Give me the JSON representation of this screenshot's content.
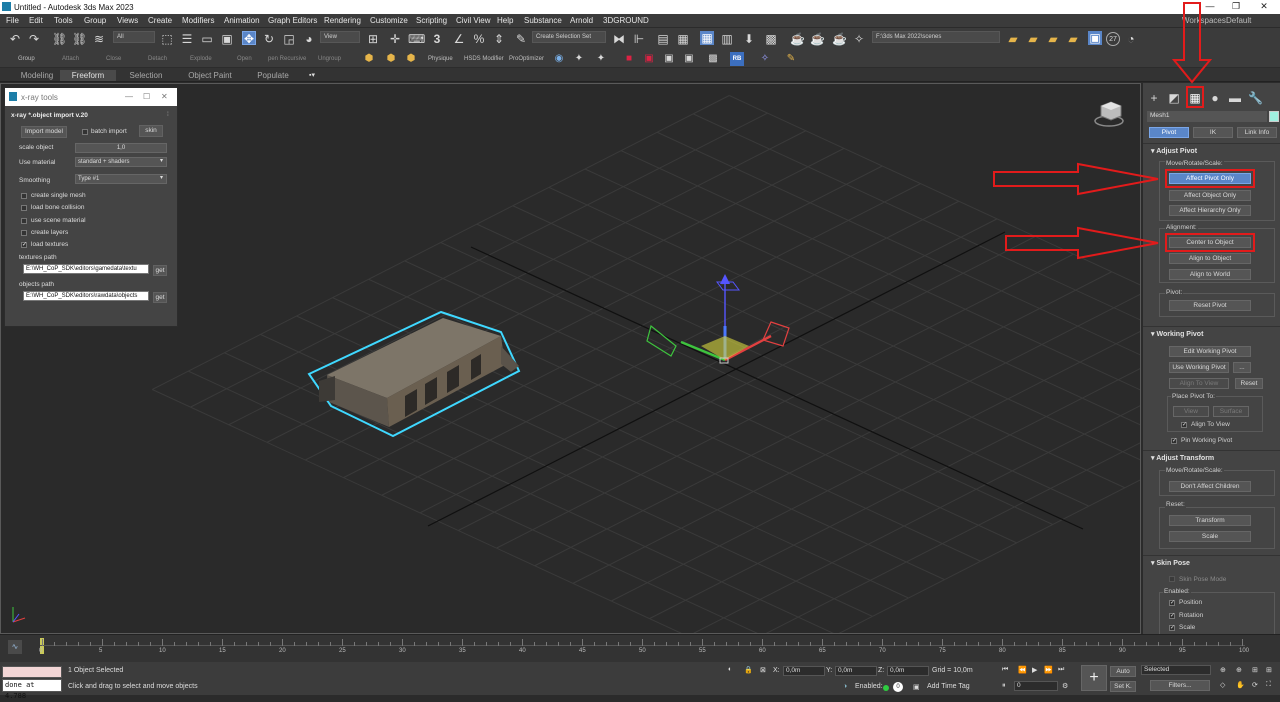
{
  "window": {
    "title": "Untitled - Autodesk 3ds Max 2023",
    "min": "—",
    "max": "❐",
    "close": "✕"
  },
  "menu": [
    "File",
    "Edit",
    "Tools",
    "Group",
    "Views",
    "Create",
    "Modifiers",
    "Animation",
    "Graph Editors",
    "Rendering",
    "Customize",
    "Scripting",
    "Civil View",
    "Help",
    "Substance",
    "Arnold",
    "3DGROUND"
  ],
  "workspace": {
    "label": "Workspaces:",
    "value": "Default"
  },
  "toolbar": {
    "filter": "All",
    "view": "View",
    "selection_set": "Create Selection Set",
    "project_path": "F:\\3ds Max 2022\\scenes",
    "spinner_value": "3",
    "row2": [
      "Group",
      "Attach",
      "Close",
      "Detach",
      "Explode",
      "Open",
      "pen Recursive",
      "Ungroup",
      "Physique",
      "HSDS Modifier",
      "ProOptimizer",
      "RB"
    ]
  },
  "ribbon": {
    "tabs": [
      "Modeling",
      "Freeform",
      "Selection",
      "Object Paint",
      "Populate"
    ],
    "active": "Freeform"
  },
  "xray": {
    "title": "x-ray tools",
    "min": "—",
    "restore": "☐",
    "close": "✕",
    "section": "x-ray *.object import v.20",
    "import_model": "Import model",
    "batch_import": "batch import",
    "skin": "skin",
    "scale_label": "scale object",
    "scale_value": "1,0",
    "material_label": "Use material",
    "material_value": "standard + shaders",
    "smoothing_label": "Smoothing",
    "smoothing_value": "Type #1",
    "checks": [
      {
        "label": "create single mesh",
        "checked": false
      },
      {
        "label": "load bone collision",
        "checked": false
      },
      {
        "label": "use scene material",
        "checked": false
      },
      {
        "label": "create layers",
        "checked": false
      },
      {
        "label": "load textures",
        "checked": true
      }
    ],
    "textures_label": "textures path",
    "textures_value": "E:\\WH_CoP_SDK\\editors\\gamedata\\textu",
    "objects_label": "objects path",
    "objects_value": "E:\\WH_CoP_SDK\\editors\\rawdata\\objects",
    "get": "get"
  },
  "cmd": {
    "object_name": "Mesh1",
    "tabs": [
      "Pivot",
      "IK",
      "Link Info"
    ],
    "adjust_pivot": "Adjust Pivot",
    "move_rotate_scale": "Move/Rotate/Scale:",
    "affect_pivot": "Affect Pivot Only",
    "affect_object": "Affect Object Only",
    "affect_hierarchy": "Affect Hierarchy Only",
    "alignment": "Alignment:",
    "center_to_object": "Center to Object",
    "align_to_object": "Align to Object",
    "align_to_world": "Align to World",
    "pivot": "Pivot:",
    "reset_pivot": "Reset Pivot",
    "working_pivot": "Working Pivot",
    "edit_wp": "Edit Working Pivot",
    "use_wp": "Use Working Pivot",
    "dots": "...",
    "align_to_view": "Align To View",
    "reset": "Reset",
    "place_pivot_to": "Place Pivot To:",
    "view": "View",
    "surface": "Surface",
    "align_to_view_chk": "Align To View",
    "pin_wp": "Pin Working Pivot",
    "adjust_transform": "Adjust Transform",
    "mrs2": "Move/Rotate/Scale:",
    "dont_affect": "Don't Affect Children",
    "reset2": "Reset:",
    "transform": "Transform",
    "scale": "Scale",
    "skin_pose": "Skin Pose",
    "skin_pose_mode": "Skin Pose Mode",
    "enabled": "Enabled:",
    "position": "Position",
    "rotation": "Rotation",
    "scale_chk": "Scale"
  },
  "timeline": {
    "ticks": [
      "0",
      "5",
      "10",
      "15",
      "20",
      "25",
      "30",
      "35",
      "40",
      "45",
      "50",
      "55",
      "60",
      "65",
      "70",
      "75",
      "80",
      "85",
      "90",
      "95",
      "100"
    ]
  },
  "status": {
    "maxscript": "done at 4.788",
    "selected": "1 Object Selected",
    "hint": "Click and drag to select and move objects",
    "x": "0,0m",
    "y": "0,0m",
    "z": "0,0m",
    "grid": "Grid = 10,0m",
    "enabled": "Enabled:",
    "add_time_tag": "Add Time Tag",
    "auto": "Auto",
    "setk": "Set K.",
    "sel": "Selected",
    "filters": "Filters...",
    "frame": "0",
    "zero": "0"
  },
  "colors": {
    "accent": "#5a86c8",
    "highlight": "#e21b1b",
    "selection": "#3fd8ff"
  }
}
